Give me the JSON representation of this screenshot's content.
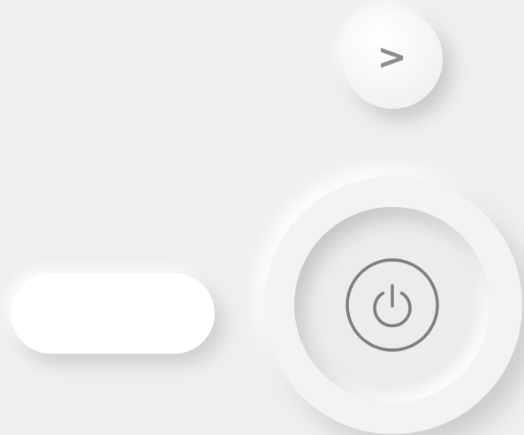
{
  "next_button": {
    "label": ">",
    "icon": "chevron-right-icon"
  },
  "power_button": {
    "icon": "power-icon"
  },
  "colors": {
    "background": "#efefef",
    "icon_gray": "#808080",
    "pill": "#ffffff"
  }
}
